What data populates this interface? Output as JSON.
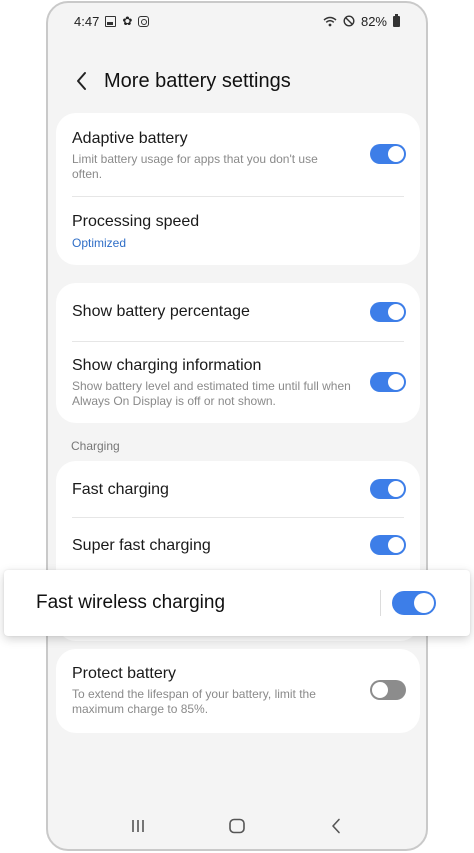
{
  "status_bar": {
    "time": "4:47",
    "battery_percent": "82%",
    "icons_left": [
      "image-icon",
      "settings-gear-icon",
      "instagram-icon"
    ],
    "icons_right": [
      "wifi-icon",
      "do-not-disturb-icon",
      "battery-icon"
    ]
  },
  "header": {
    "title": "More battery settings",
    "back_icon": "chevron-left-icon"
  },
  "group1": {
    "adaptive_battery": {
      "title": "Adaptive battery",
      "subtitle": "Limit battery usage for apps that you don't use often.",
      "toggle": "on"
    },
    "processing_speed": {
      "title": "Processing speed",
      "value": "Optimized"
    }
  },
  "group2": {
    "show_percentage": {
      "title": "Show battery percentage",
      "toggle": "on"
    },
    "show_charging_info": {
      "title": "Show charging information",
      "subtitle": "Show battery level and estimated time until full when Always On Display is off or not shown.",
      "toggle": "on"
    }
  },
  "charging_section": {
    "label": "Charging",
    "fast_charging": {
      "title": "Fast charging",
      "toggle": "on"
    },
    "super_fast_charging": {
      "title": "Super fast charging",
      "toggle": "on"
    },
    "fast_wireless_charging": {
      "title": "Fast wireless charging",
      "toggle": "on"
    }
  },
  "protect_battery": {
    "title": "Protect battery",
    "subtitle": "To extend the lifespan of your battery, limit the maximum charge to 85%.",
    "toggle": "off"
  },
  "nav_bar": {
    "items": [
      "recent-apps-icon",
      "home-icon",
      "back-icon"
    ]
  },
  "colors": {
    "accent": "#3d7ee8",
    "link": "#2f6ec7",
    "toggle_off": "#8c8c8c",
    "background": "#f4f4f4",
    "card": "#ffffff"
  }
}
